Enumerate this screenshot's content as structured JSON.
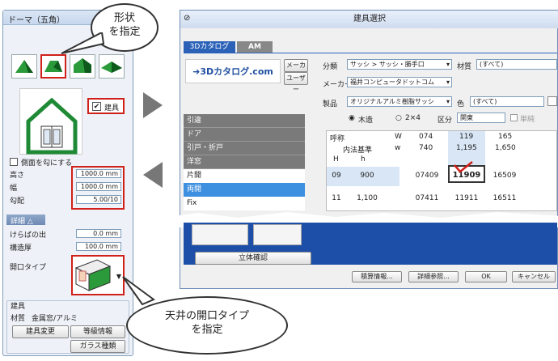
{
  "left_panel": {
    "title": "ドーマ（五角）",
    "checkbox_label": "建具",
    "side_label": "側面を勾にする",
    "height_label": "高さ",
    "height_value": "1000.0 mm",
    "width_label": "幅",
    "width_value": "1000.0 mm",
    "slope_label": "勾配",
    "slope_value": "5.00/10",
    "detail_label": "詳細",
    "eave_label": "けらばの出",
    "eave_value": "0.0 mm",
    "thick_label": "構造厚",
    "thick_value": "100.0 mm",
    "opening_label": "開口タイプ",
    "fitting_label": "建具",
    "material_label": "材質",
    "material_value": "金属窓/アルミ",
    "btn_change": "建具変更",
    "btn_rank": "等級情報",
    "btn_glass": "ガラス種類"
  },
  "callouts": {
    "shape": "形状\nを指定",
    "ceiling": "天井の開口タイプ\nを指定"
  },
  "dialog": {
    "title": "建具選択",
    "tab1": "3Dカタログ",
    "tab2": "AM",
    "logo": "➜3Dカタログ.com",
    "maker_btn": "メーカー",
    "user_btn": "ユーザー",
    "class_label": "分類",
    "class_value": "サッシ > サッシ・勝手口",
    "material_label": "材質",
    "material_value": "(すべて)",
    "maker_label": "メーカー",
    "maker_value": "福井コンピュータドットコム",
    "product_label": "製品",
    "product_value": "オリジナルアルミ樹脂サッシ",
    "color_label": "色",
    "color_value": "(すべて)",
    "radio1": "木造",
    "radio2": "2×4",
    "div_label": "区分",
    "div_value": "関東",
    "single_label": "単純",
    "cat_items": [
      "引違",
      "ドア",
      "引戸・折戸",
      "洋窓",
      "片開",
      "両開",
      "Fix"
    ],
    "table": {
      "h_yobi": "呼称",
      "h_w": "W",
      "h_naiho": "内法基準",
      "h_w2": "w",
      "h_H": "H",
      "h_h": "h",
      "cols": [
        {
          "code": "074",
          "w": "740"
        },
        {
          "code": "119",
          "w": "1,195"
        },
        {
          "code": "165",
          "w": "1,650"
        }
      ],
      "rows": [
        {
          "code": "09",
          "h": "900",
          "cells": [
            "07409",
            "11909",
            "16509"
          ]
        },
        {
          "code": "11",
          "h": "1,100",
          "cells": [
            "07411",
            "11911",
            "16511"
          ]
        }
      ]
    },
    "btn_3d": "立体確認",
    "btn_est": "積算情報...",
    "btn_detail": "詳細参照...",
    "btn_ok": "OK",
    "btn_cancel": "キャンセル"
  }
}
